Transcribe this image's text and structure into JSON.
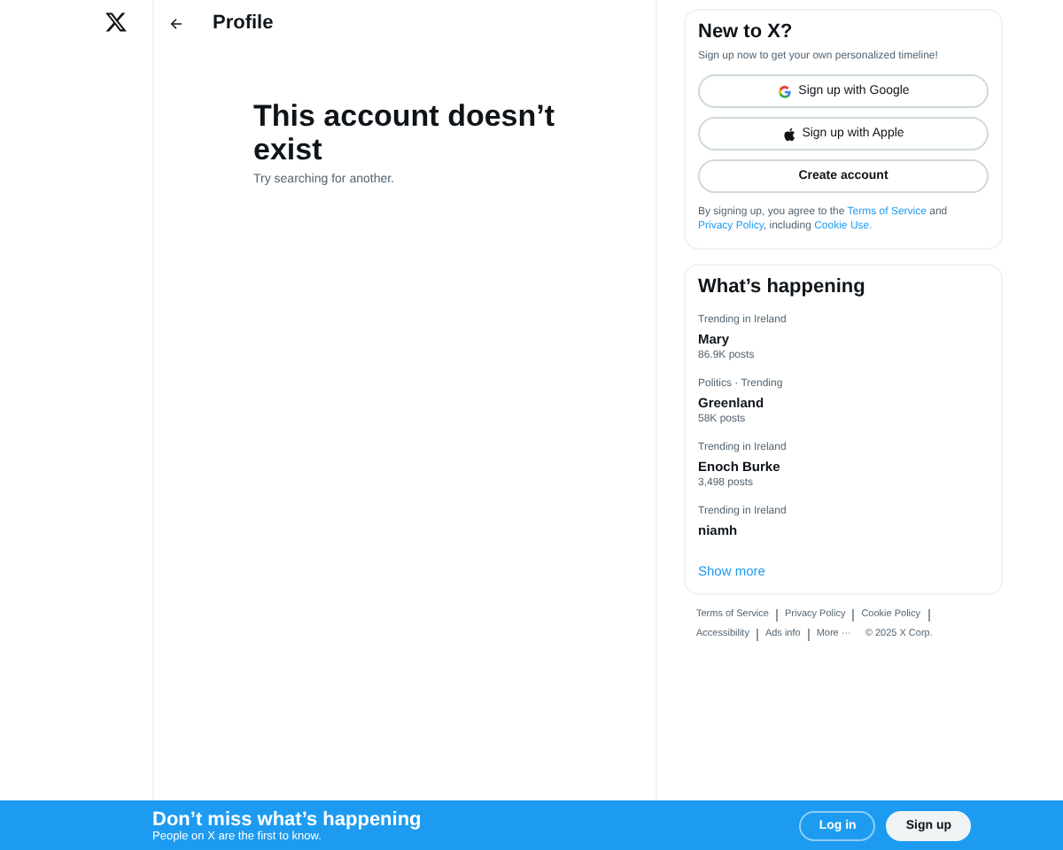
{
  "header": {
    "title": "Profile"
  },
  "empty_state": {
    "title": "This account doesn’t exist",
    "subtitle": "Try searching for another."
  },
  "signup_card": {
    "title": "New to X?",
    "subtitle": "Sign up now to get your own personalized timeline!",
    "buttons": [
      {
        "kind": "google",
        "label": "Sign up with Google"
      },
      {
        "kind": "apple",
        "label": "Sign up with Apple"
      },
      {
        "kind": "plain",
        "label": "Create account"
      }
    ],
    "legal": [
      {
        "kind": "text",
        "text": "By signing up, you agree to the "
      },
      {
        "kind": "link",
        "text": "Terms of Service"
      },
      {
        "kind": "text",
        "text": " and "
      },
      {
        "kind": "link",
        "text": "Privacy Policy"
      },
      {
        "kind": "text",
        "text": ", including "
      },
      {
        "kind": "link",
        "text": "Cookie Use."
      }
    ]
  },
  "trends": {
    "title": "What’s happening",
    "items": [
      {
        "context": "Trending in Ireland",
        "name": "Mary",
        "posts": "86.9K posts"
      },
      {
        "context": "Politics · Trending",
        "name": "Greenland",
        "posts": "58K posts"
      },
      {
        "context": "Trending in Ireland",
        "name": "Enoch Burke",
        "posts": "3,498 posts"
      },
      {
        "context": "Trending in Ireland",
        "name": "niamh"
      }
    ],
    "show_more": "Show more"
  },
  "footer_links": [
    {
      "text": "Terms of Service",
      "separator": true
    },
    {
      "text": "Privacy Policy",
      "separator": true
    },
    {
      "text": "Cookie Policy",
      "separator": true
    },
    {
      "text": "Accessibility",
      "separator": true
    },
    {
      "text": "Ads info",
      "separator": true
    },
    {
      "text": "More ···",
      "separator": false
    },
    {
      "text": "© 2025 X Corp.",
      "separator": false
    }
  ],
  "bottom_bar": {
    "title": "Don’t miss what’s happening",
    "subtitle": "People on X are the first to know.",
    "login": "Log in",
    "signup": "Sign up"
  }
}
